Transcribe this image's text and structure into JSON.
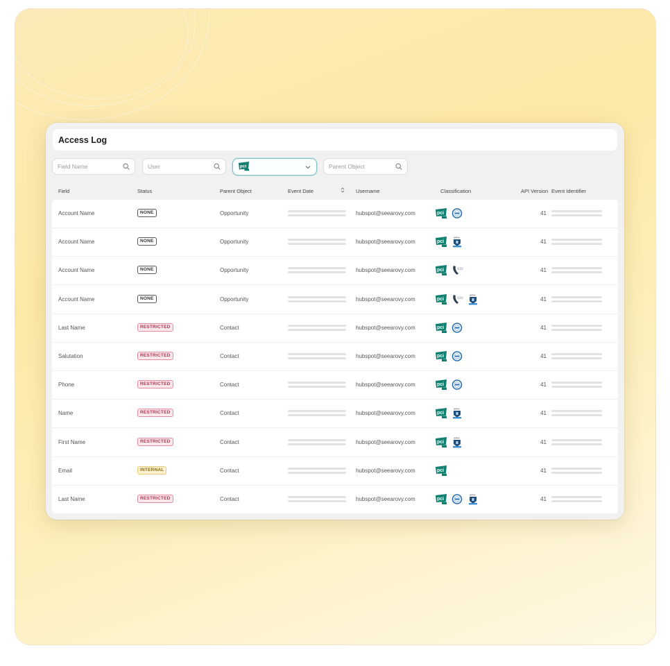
{
  "page": {
    "title": "Access Log"
  },
  "filters": {
    "field_name": {
      "placeholder": "Field Name",
      "icon": "search-icon"
    },
    "user": {
      "placeholder": "User",
      "icon": "search-icon"
    },
    "classification": {
      "selected": "pci-icon",
      "icon": "chevron-down-icon"
    },
    "parent_object": {
      "placeholder": "Parent Object",
      "icon": "search-icon"
    }
  },
  "columns": {
    "field": "Field",
    "status": "Status",
    "parent_object": "Parent Object",
    "event_date": "Event Date",
    "username": "Username",
    "classification": "Classification",
    "api_version": "API Version",
    "event_identifier": "Event Identifier"
  },
  "colors": {
    "accent_teal": "#0f7f6f",
    "restricted": "#b03050",
    "internal": "#8a6a10",
    "backdrop": "#fde9a6"
  },
  "rows": [
    {
      "field": "Account Name",
      "status": "NONE",
      "status_type": "none",
      "parent_object": "Opportunity",
      "username": "hubspot@seearovy.com",
      "classification": [
        "pci-icon",
        "gdpr-icon"
      ],
      "api_version": "41"
    },
    {
      "field": "Account Name",
      "status": "NONE",
      "status_type": "none",
      "parent_object": "Opportunity",
      "username": "hubspot@seearovy.com",
      "classification": [
        "pci-icon",
        "hipaa-icon"
      ],
      "api_version": "41"
    },
    {
      "field": "Account Name",
      "status": "NONE",
      "status_type": "none",
      "parent_object": "Opportunity",
      "username": "hubspot@seearovy.com",
      "classification": [
        "pci-icon",
        "ccpa-icon"
      ],
      "api_version": "41"
    },
    {
      "field": "Account Name",
      "status": "NONE",
      "status_type": "none",
      "parent_object": "Opportunity",
      "username": "hubspot@seearovy.com",
      "classification": [
        "pci-icon",
        "ccpa-icon",
        "hipaa-icon"
      ],
      "api_version": "41"
    },
    {
      "field": "Last Name",
      "status": "RESTRICTED",
      "status_type": "restricted",
      "parent_object": "Contact",
      "username": "hubspot@seearovy.com",
      "classification": [
        "pci-icon",
        "gdpr-icon"
      ],
      "api_version": "41"
    },
    {
      "field": "Salutation",
      "status": "RESTRICTED",
      "status_type": "restricted",
      "parent_object": "Contact",
      "username": "hubspot@seearovy.com",
      "classification": [
        "pci-icon",
        "gdpr-icon"
      ],
      "api_version": "41"
    },
    {
      "field": "Phone",
      "status": "RESTRICTED",
      "status_type": "restricted",
      "parent_object": "Contact",
      "username": "hubspot@seearovy.com",
      "classification": [
        "pci-icon",
        "gdpr-icon"
      ],
      "api_version": "41"
    },
    {
      "field": "Name",
      "status": "RESTRICTED",
      "status_type": "restricted",
      "parent_object": "Contact",
      "username": "hubspot@seearovy.com",
      "classification": [
        "pci-icon",
        "hipaa-icon"
      ],
      "api_version": "41"
    },
    {
      "field": "First Name",
      "status": "RESTRICTED",
      "status_type": "restricted",
      "parent_object": "Contact",
      "username": "hubspot@seearovy.com",
      "classification": [
        "pci-icon",
        "hipaa-icon"
      ],
      "api_version": "41"
    },
    {
      "field": "Email",
      "status": "INTERNAL",
      "status_type": "internal",
      "parent_object": "Contact",
      "username": "hubspot@seearovy.com",
      "classification": [
        "pci-icon"
      ],
      "api_version": "41"
    },
    {
      "field": "Last Name",
      "status": "RESTRICTED",
      "status_type": "restricted",
      "parent_object": "Contact",
      "username": "hubspot@seearovy.com",
      "classification": [
        "pci-icon",
        "gdpr-icon",
        "hipaa-icon"
      ],
      "api_version": "41"
    }
  ]
}
